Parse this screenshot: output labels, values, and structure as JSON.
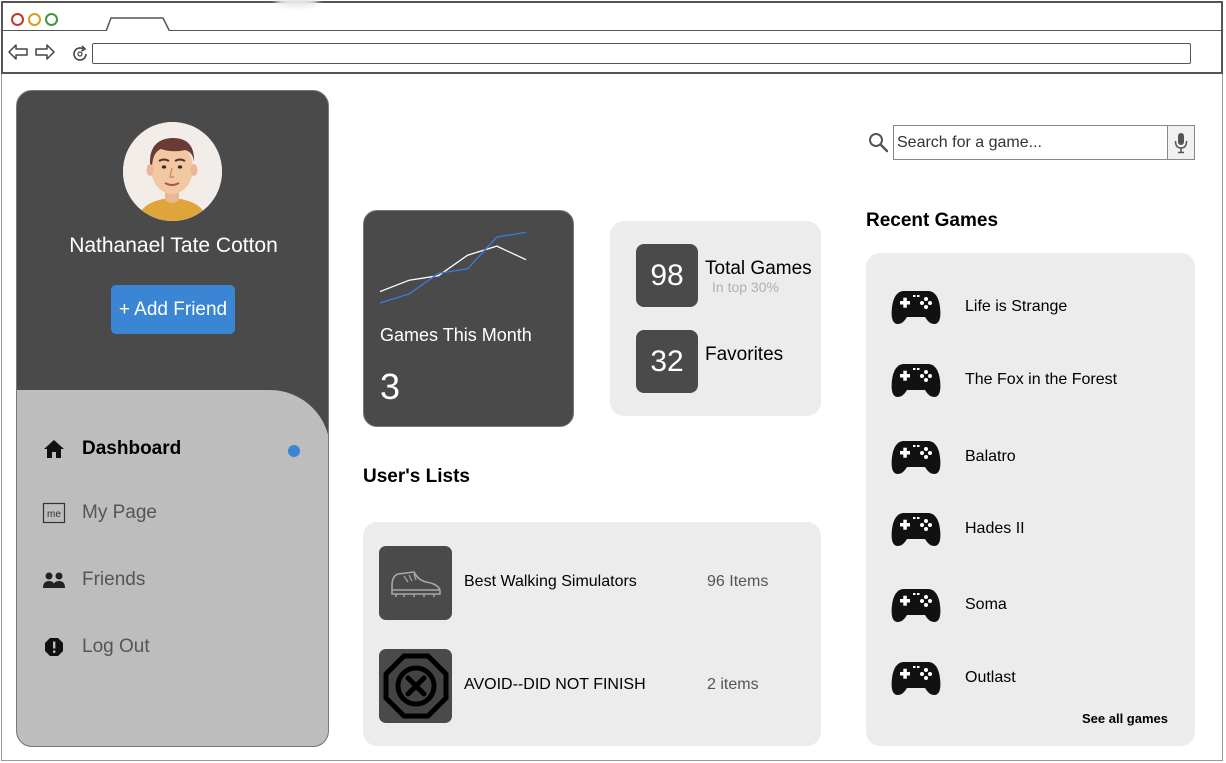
{
  "user": {
    "name": "Nathanael Tate Cotton",
    "add_friend_label": "+ Add Friend"
  },
  "nav": [
    {
      "label": "Dashboard",
      "icon": "home-icon",
      "active": true
    },
    {
      "label": "My Page",
      "icon": "me-icon",
      "active": false
    },
    {
      "label": "Friends",
      "icon": "friends-icon",
      "active": false
    },
    {
      "label": "Log Out",
      "icon": "alert-icon",
      "active": false
    }
  ],
  "search": {
    "placeholder": "Search for a game..."
  },
  "games_month": {
    "label": "Games This Month",
    "value": "3",
    "chart_data": {
      "type": "line",
      "series": [
        {
          "values": [
            1,
            2,
            2.4,
            4.2,
            5,
            3.8
          ]
        },
        {
          "values": [
            0,
            0.8,
            2.6,
            3,
            5.8,
            6.2
          ]
        }
      ]
    }
  },
  "stats": {
    "total_games": {
      "value": "98",
      "label": "Total Games",
      "sub": "In top 30%"
    },
    "favorites": {
      "value": "32",
      "label": "Favorites"
    }
  },
  "lists": {
    "title": "User's Lists",
    "items": [
      {
        "name": "Best Walking Simulators",
        "count": "96 Items",
        "icon": "shoe-icon"
      },
      {
        "name": "AVOID--DID NOT FINISH",
        "count": "2 items",
        "icon": "stop-x-icon"
      }
    ]
  },
  "recent": {
    "title": "Recent Games",
    "games": [
      "Life is Strange",
      "The Fox in the Forest",
      "Balatro",
      "Hades II",
      "Soma",
      "Outlast"
    ],
    "see_all_label": "See all games"
  },
  "colors": {
    "accent": "#3a86d4",
    "dark_card": "#4a4a4a",
    "light_card": "#ececec",
    "nav_panel": "#bdbdbd"
  }
}
